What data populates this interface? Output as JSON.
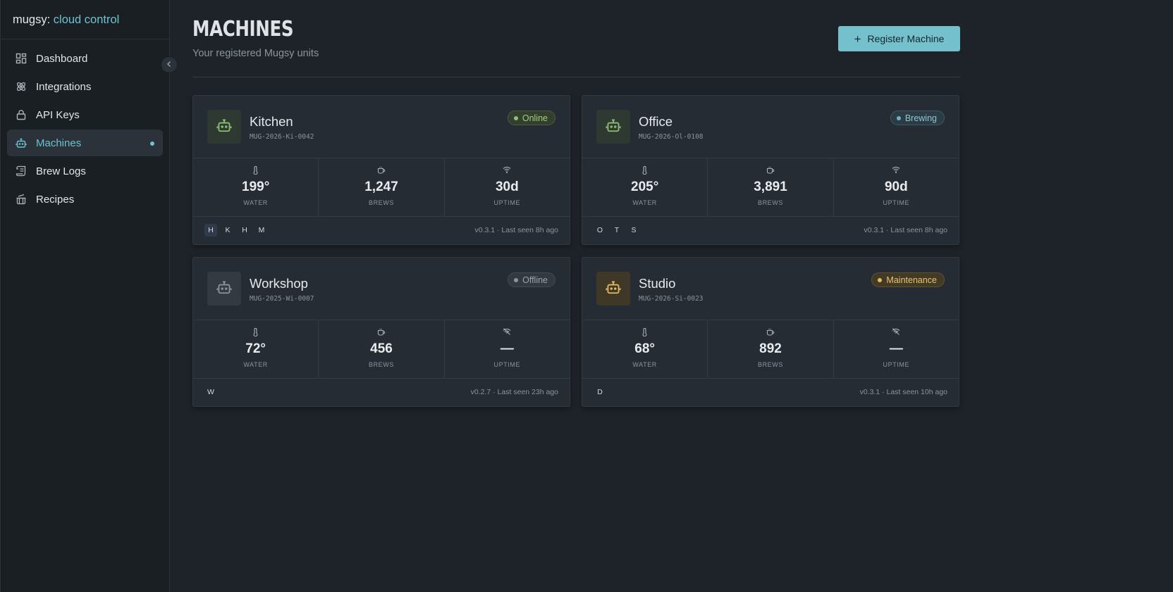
{
  "brand": {
    "prefix": "mugsy:",
    "accent": "cloud control"
  },
  "sidebar": {
    "items": [
      {
        "label": "Dashboard",
        "icon": "dashboard-icon"
      },
      {
        "label": "Integrations",
        "icon": "integrations-icon"
      },
      {
        "label": "API Keys",
        "icon": "lock-icon"
      },
      {
        "label": "Machines",
        "icon": "robot-icon",
        "active": true
      },
      {
        "label": "Brew Logs",
        "icon": "scroll-icon"
      },
      {
        "label": "Recipes",
        "icon": "pot-icon"
      }
    ]
  },
  "header": {
    "title": "MACHINES",
    "subtitle": "Your registered Mugsy units",
    "register_label": "Register Machine"
  },
  "colors": {
    "accent": "#6cc3d1",
    "online": "#8fbf72",
    "brewing": "#6fb1c4",
    "offline": "#8b949c",
    "maintenance": "#e2b964"
  },
  "machines": [
    {
      "name": "Kitchen",
      "id": "MUG-2026-Ki-0042",
      "status": "Online",
      "water": "199°",
      "water_label": "WATER",
      "brews": "1,247",
      "brews_label": "BREWS",
      "uptime": "30d",
      "uptime_label": "UPTIME",
      "tags": [
        "H",
        "K",
        "H",
        "M"
      ],
      "meta": "v0.3.1 · Last seen 8h ago"
    },
    {
      "name": "Office",
      "id": "MUG-2026-Ol-0108",
      "status": "Brewing",
      "water": "205°",
      "water_label": "WATER",
      "brews": "3,891",
      "brews_label": "BREWS",
      "uptime": "90d",
      "uptime_label": "UPTIME",
      "tags": [
        "O",
        "T",
        "S"
      ],
      "meta": "v0.3.1 · Last seen 8h ago"
    },
    {
      "name": "Workshop",
      "id": "MUG-2025-Wi-0007",
      "status": "Offline",
      "water": "72°",
      "water_label": "WATER",
      "brews": "456",
      "brews_label": "BREWS",
      "uptime": "—",
      "uptime_label": "UPTIME",
      "tags": [
        "W"
      ],
      "meta": "v0.2.7 · Last seen 23h ago"
    },
    {
      "name": "Studio",
      "id": "MUG-2026-Si-0023",
      "status": "Maintenance",
      "water": "68°",
      "water_label": "WATER",
      "brews": "892",
      "brews_label": "BREWS",
      "uptime": "—",
      "uptime_label": "UPTIME",
      "tags": [
        "D"
      ],
      "meta": "v0.3.1 · Last seen 10h ago"
    }
  ]
}
